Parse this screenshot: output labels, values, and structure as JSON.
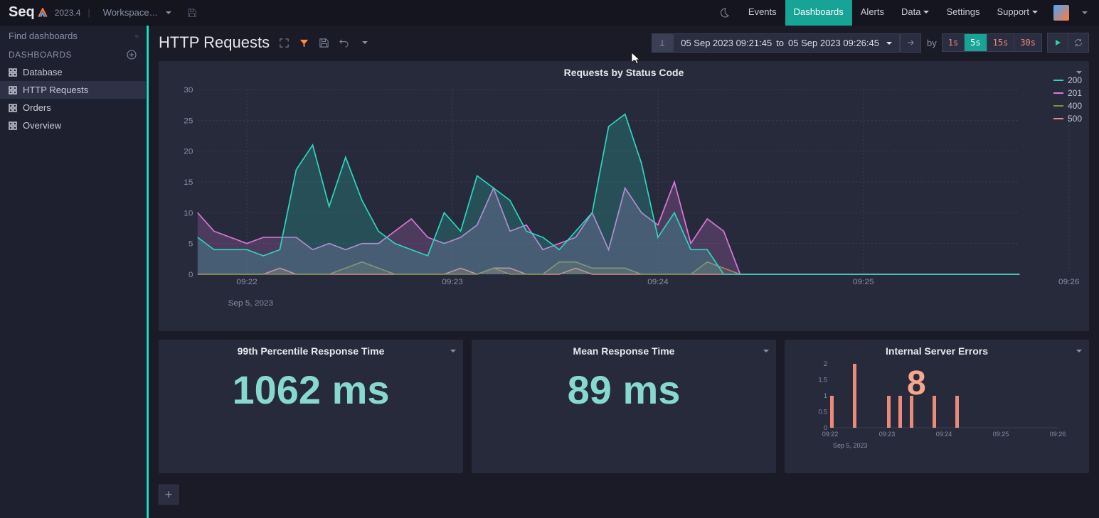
{
  "app": {
    "name": "Seq",
    "version": "2023.4",
    "workspace": "Workspace…"
  },
  "nav": {
    "events": "Events",
    "dashboards": "Dashboards",
    "alerts": "Alerts",
    "data": "Data",
    "settings": "Settings",
    "support": "Support"
  },
  "sidebar": {
    "search_placeholder": "Find dashboards",
    "section": "DASHBOARDS",
    "items": [
      {
        "label": "Database"
      },
      {
        "label": "HTTP Requests"
      },
      {
        "label": "Orders"
      },
      {
        "label": "Overview"
      }
    ]
  },
  "page": {
    "title": "HTTP Requests"
  },
  "timerange": {
    "from": "05 Sep 2023 09:21:45",
    "to_label": "to",
    "to": "05 Sep 2023 09:26:45",
    "by_label": "by"
  },
  "intervals": [
    "1s",
    "5s",
    "15s",
    "30s"
  ],
  "chart": {
    "title": "Requests by Status Code",
    "date_label": "Sep 5, 2023",
    "legend": [
      {
        "name": "200",
        "color": "#2dd6c0"
      },
      {
        "name": "201",
        "color": "#d979d9"
      },
      {
        "name": "400",
        "color": "#8a8a42"
      },
      {
        "name": "500",
        "color": "#e98a7a"
      }
    ]
  },
  "cards": {
    "p99": {
      "title": "99th Percentile Response Time",
      "value": "1062 ms"
    },
    "mean": {
      "title": "Mean Response Time",
      "value": "89 ms"
    },
    "errors": {
      "title": "Internal Server Errors",
      "value": "8",
      "date_label": "Sep 5, 2023"
    }
  },
  "chart_data": [
    {
      "type": "area",
      "title": "Requests by Status Code",
      "xlabel": "",
      "ylabel": "",
      "ylim": [
        0,
        30
      ],
      "yticks": [
        0,
        5,
        10,
        15,
        20,
        25,
        30
      ],
      "x_labels": [
        "09:22",
        "09:23",
        "09:24",
        "09:25",
        "09:26"
      ],
      "x": [
        0,
        1,
        2,
        3,
        4,
        5,
        6,
        7,
        8,
        9,
        10,
        11,
        12,
        13,
        14,
        15,
        16,
        17,
        18,
        19,
        20,
        21,
        22,
        23,
        24,
        25,
        26,
        27,
        28,
        29,
        30,
        31,
        32,
        33,
        34,
        35,
        36,
        37,
        38,
        39,
        40,
        41,
        42,
        43,
        44,
        45,
        46,
        47,
        48,
        49,
        50
      ],
      "series": [
        {
          "name": "200",
          "color": "#2dd6c0",
          "values": [
            6,
            4,
            4,
            4,
            3,
            4,
            17,
            21,
            11,
            19,
            12,
            7,
            5,
            4,
            3,
            10,
            7,
            16,
            14,
            12,
            7,
            6,
            4,
            7,
            10,
            24,
            26,
            18,
            6,
            10,
            4,
            4,
            0,
            0,
            0,
            0,
            0,
            0,
            0,
            0,
            0,
            0,
            0,
            0,
            0,
            0,
            0,
            0,
            0,
            0,
            0
          ]
        },
        {
          "name": "201",
          "color": "#d979d9",
          "values": [
            10,
            7,
            6,
            5,
            6,
            6,
            6,
            4,
            5,
            4,
            5,
            5,
            7,
            9,
            6,
            5,
            6,
            8,
            14,
            7,
            8,
            4,
            5,
            6,
            10,
            4,
            14,
            10,
            8,
            15,
            5,
            9,
            7,
            0,
            0,
            0,
            0,
            0,
            0,
            0,
            0,
            0,
            0,
            0,
            0,
            0,
            0,
            0,
            0,
            0,
            0
          ]
        },
        {
          "name": "400",
          "color": "#8a8a42",
          "values": [
            0,
            0,
            0,
            0,
            0,
            0,
            0,
            0,
            0,
            1,
            2,
            1,
            0,
            0,
            0,
            0,
            0,
            0,
            1,
            0,
            0,
            0,
            2,
            2,
            1,
            1,
            1,
            0,
            0,
            0,
            0,
            2,
            1,
            0,
            0,
            0,
            0,
            0,
            0,
            0,
            0,
            0,
            0,
            0,
            0,
            0,
            0,
            0,
            0,
            0,
            0
          ]
        },
        {
          "name": "500",
          "color": "#e98a7a",
          "values": [
            0,
            0,
            0,
            0,
            0,
            1,
            0,
            0,
            0,
            0,
            0,
            0,
            0,
            0,
            0,
            0,
            1,
            0,
            1,
            1,
            0,
            0,
            0,
            1,
            0,
            0,
            0,
            0,
            0,
            0,
            0,
            0,
            0,
            0,
            0,
            0,
            0,
            0,
            0,
            0,
            0,
            0,
            0,
            0,
            0,
            0,
            0,
            0,
            0,
            0,
            0
          ]
        }
      ]
    },
    {
      "type": "bar",
      "title": "Internal Server Errors",
      "ylim": [
        0,
        2
      ],
      "yticks": [
        0,
        0.5,
        1,
        1.5,
        2
      ],
      "x_labels": [
        "09:22",
        "09:23",
        "09:24",
        "09:25",
        "09:26"
      ],
      "categories": [
        0,
        2,
        5,
        6,
        7,
        9,
        11,
        13
      ],
      "values": [
        1,
        2,
        1,
        1,
        1,
        1,
        1,
        0
      ],
      "color": "#e98a7a",
      "total": 8
    }
  ]
}
